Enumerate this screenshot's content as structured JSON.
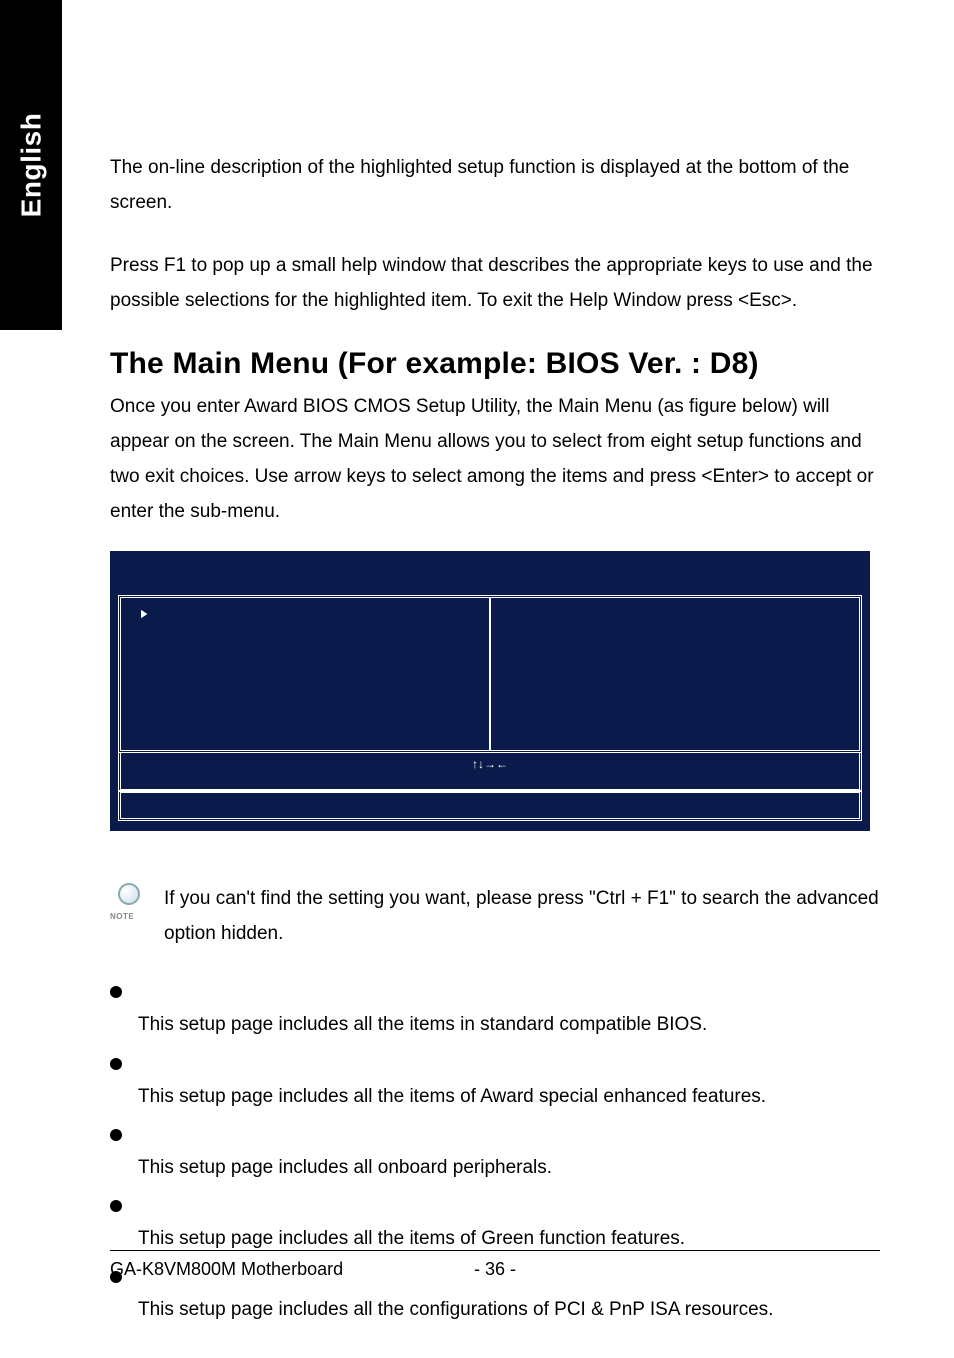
{
  "side_tab": "English",
  "intro_para1": "The on-line description of the highlighted setup function is displayed at the bottom of the screen.",
  "intro_para2": "Press F1 to pop up a small help window that describes the appropriate keys to use and the possible selections for the highlighted item. To exit the Help Window press <Esc>.",
  "heading": "The Main Menu (For example: BIOS Ver. : D8)",
  "main_para": "Once you enter Award BIOS CMOS Setup Utility, the Main Menu (as figure below) will appear on the screen. The Main Menu allows you to select from eight setup functions and two exit choices. Use arrow keys to select among the items and press <Enter> to accept or enter the sub-menu.",
  "bios": {
    "left_items": [
      "",
      "",
      "",
      "",
      "",
      "",
      ""
    ],
    "hint_arrows": "↑↓→←"
  },
  "note": {
    "icon_label": "NOTE",
    "text": "If you can't find the setting you want, please press \"Ctrl + F1\" to search the advanced option hidden."
  },
  "bullets": [
    {
      "desc": "This setup page includes all the items in standard compatible BIOS."
    },
    {
      "desc": "This setup page includes all the items of Award special enhanced features."
    },
    {
      "desc": "This setup page includes all onboard peripherals."
    },
    {
      "desc": "This setup page includes all the items of Green function features."
    },
    {
      "desc": "This setup page includes all the configurations of PCI & PnP ISA resources."
    }
  ],
  "footer": {
    "left": "GA-K8VM800M Motherboard",
    "center": "- 36 -"
  }
}
